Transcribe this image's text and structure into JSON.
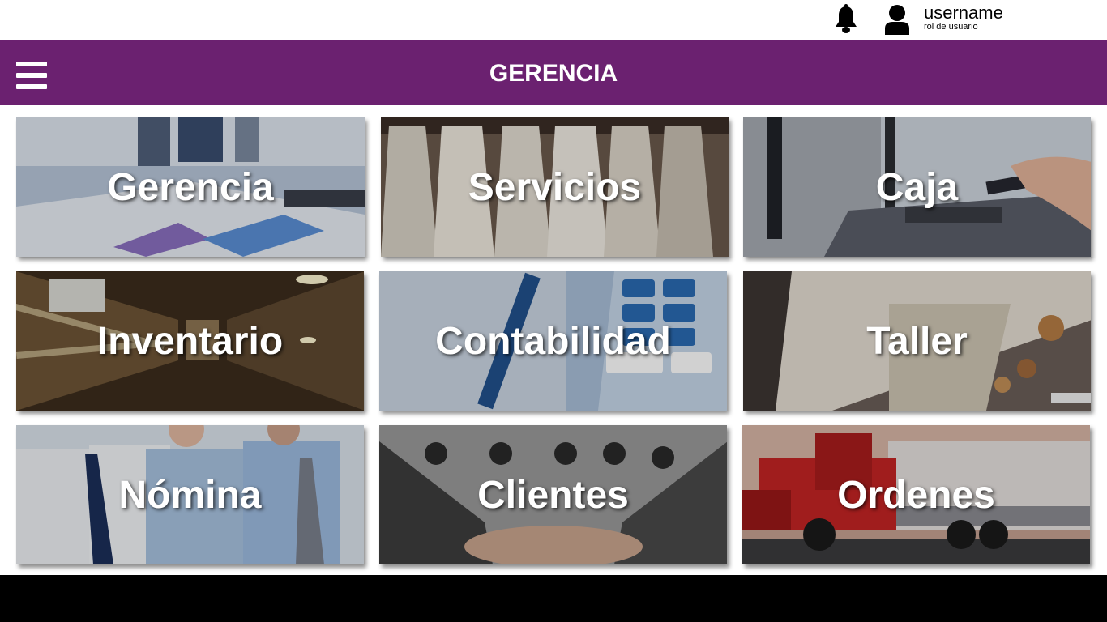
{
  "topbar": {
    "bell_icon": "bell-icon",
    "avatar_icon": "user-icon",
    "username": "username",
    "role": "rol de usuario"
  },
  "header": {
    "menu_icon": "hamburger-menu-icon",
    "title": "GERENCIA",
    "color": "#6b2170"
  },
  "tiles": [
    {
      "label": "Gerencia"
    },
    {
      "label": "Servicios"
    },
    {
      "label": "Caja"
    },
    {
      "label": "Inventario"
    },
    {
      "label": "Contabilidad"
    },
    {
      "label": "Taller"
    },
    {
      "label": "Nómina"
    },
    {
      "label": "Clientes"
    },
    {
      "label": "Ordenes"
    }
  ]
}
